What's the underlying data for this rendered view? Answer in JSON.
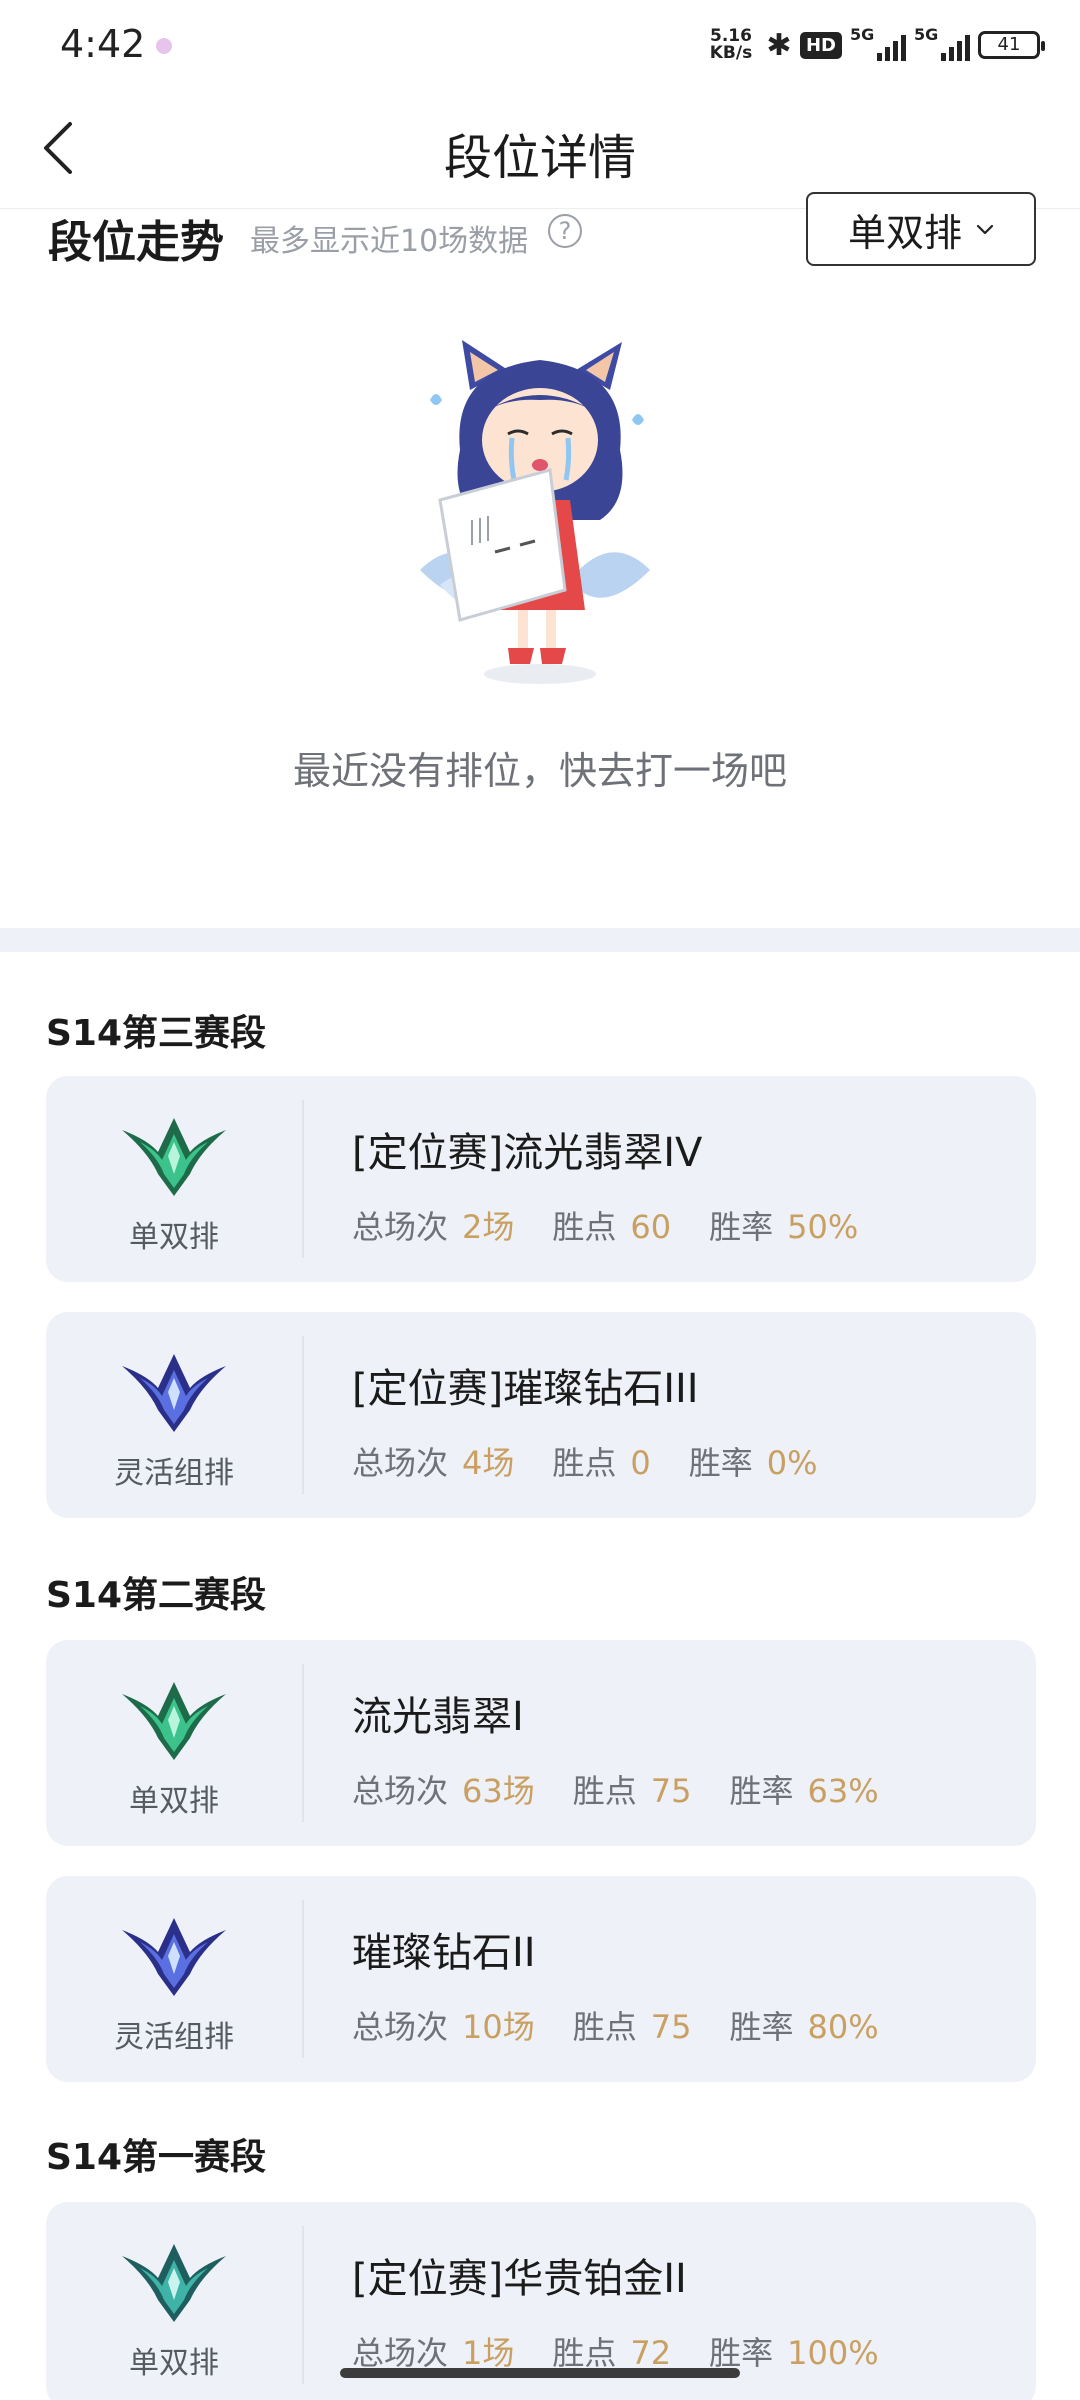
{
  "status_bar": {
    "time": "4:42",
    "net_speed_value": "5.16",
    "net_speed_unit": "KB/s",
    "hd_label": "HD",
    "sim1_label": "5G",
    "sim2_label": "5G",
    "battery": "41"
  },
  "header": {
    "title": "段位详情",
    "back_icon": "chevron-left-icon"
  },
  "trend": {
    "title": "段位走势",
    "hint": "最多显示近10场数据",
    "help_symbol": "?",
    "queue_selected": "单双排",
    "empty_message": "最近没有排位，快去打一场吧"
  },
  "stat_labels": {
    "games": "总场次",
    "points": "胜点",
    "winrate": "胜率"
  },
  "seasons": [
    {
      "title": "S14第三赛段",
      "ranks": [
        {
          "queue": "单双排",
          "rank": "[定位赛]流光翡翠IV",
          "games": "2场",
          "points": "60",
          "winrate": "50%",
          "emblem": "emerald-emblem-icon"
        },
        {
          "queue": "灵活组排",
          "rank": "[定位赛]璀璨钻石III",
          "games": "4场",
          "points": "0",
          "winrate": "0%",
          "emblem": "diamond-emblem-icon"
        }
      ]
    },
    {
      "title": "S14第二赛段",
      "ranks": [
        {
          "queue": "单双排",
          "rank": "流光翡翠I",
          "games": "63场",
          "points": "75",
          "winrate": "63%",
          "emblem": "emerald-emblem-icon"
        },
        {
          "queue": "灵活组排",
          "rank": "璀璨钻石II",
          "games": "10场",
          "points": "75",
          "winrate": "80%",
          "emblem": "diamond-emblem-icon"
        }
      ]
    },
    {
      "title": "S14第一赛段",
      "ranks": [
        {
          "queue": "单双排",
          "rank": "[定位赛]华贵铂金II",
          "games": "1场",
          "points": "72",
          "winrate": "100%",
          "emblem": "platinum-emblem-icon"
        }
      ]
    }
  ],
  "colors": {
    "accent_value": "#c9a062",
    "card_bg": "#eef1f7",
    "divider_bg": "#eef2f8"
  }
}
